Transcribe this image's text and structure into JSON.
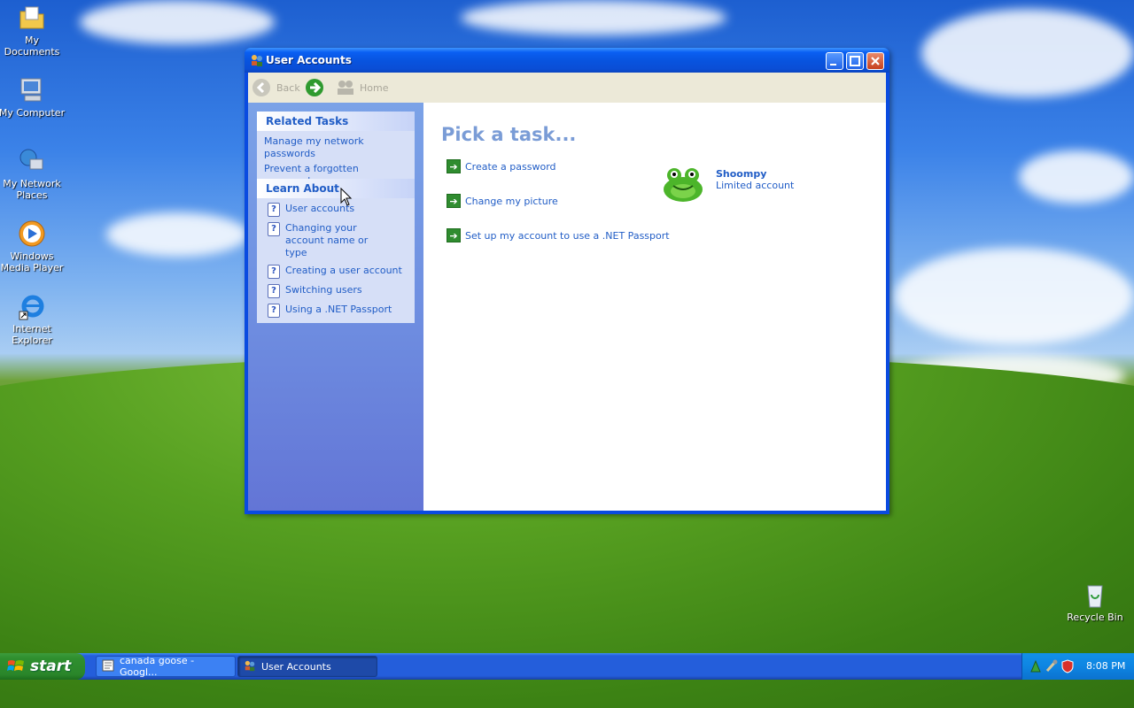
{
  "desktop": {
    "icons": [
      {
        "label": "My Documents",
        "icon": "folder-documents-icon"
      },
      {
        "label": "My Computer",
        "icon": "computer-icon"
      },
      {
        "label": "My Network Places",
        "icon": "network-places-icon"
      },
      {
        "label": "Windows Media Player",
        "icon": "media-player-icon"
      },
      {
        "label": "Internet Explorer",
        "icon": "internet-explorer-icon"
      },
      {
        "label": "Recycle Bin",
        "icon": "recycle-bin-icon"
      }
    ]
  },
  "window": {
    "title": "User Accounts",
    "toolbar": {
      "back_label": "Back",
      "home_label": "Home"
    },
    "related_tasks": {
      "heading": "Related Tasks",
      "items": [
        "Manage my network passwords",
        "Prevent a forgotten password"
      ]
    },
    "learn_about": {
      "heading": "Learn About",
      "items": [
        "User accounts",
        "Changing your account name or type",
        "Creating a user account",
        "Switching users",
        "Using a .NET Passport"
      ]
    },
    "main": {
      "heading": "Pick a task...",
      "tasks": [
        "Create a password",
        "Change my picture",
        "Set up my account to use a .NET Passport"
      ],
      "user": {
        "name": "Shoompy",
        "type": "Limited account"
      }
    }
  },
  "taskbar": {
    "start_label": "start",
    "buttons": [
      {
        "label": "canada goose - Googl...",
        "active": false
      },
      {
        "label": "User Accounts",
        "active": true
      }
    ],
    "clock": "8:08 PM"
  },
  "colors": {
    "link_blue": "#215dc6",
    "title_blue": "#0a5ff2",
    "taskbar_blue": "#245edb",
    "start_green": "#2f8f2f"
  }
}
